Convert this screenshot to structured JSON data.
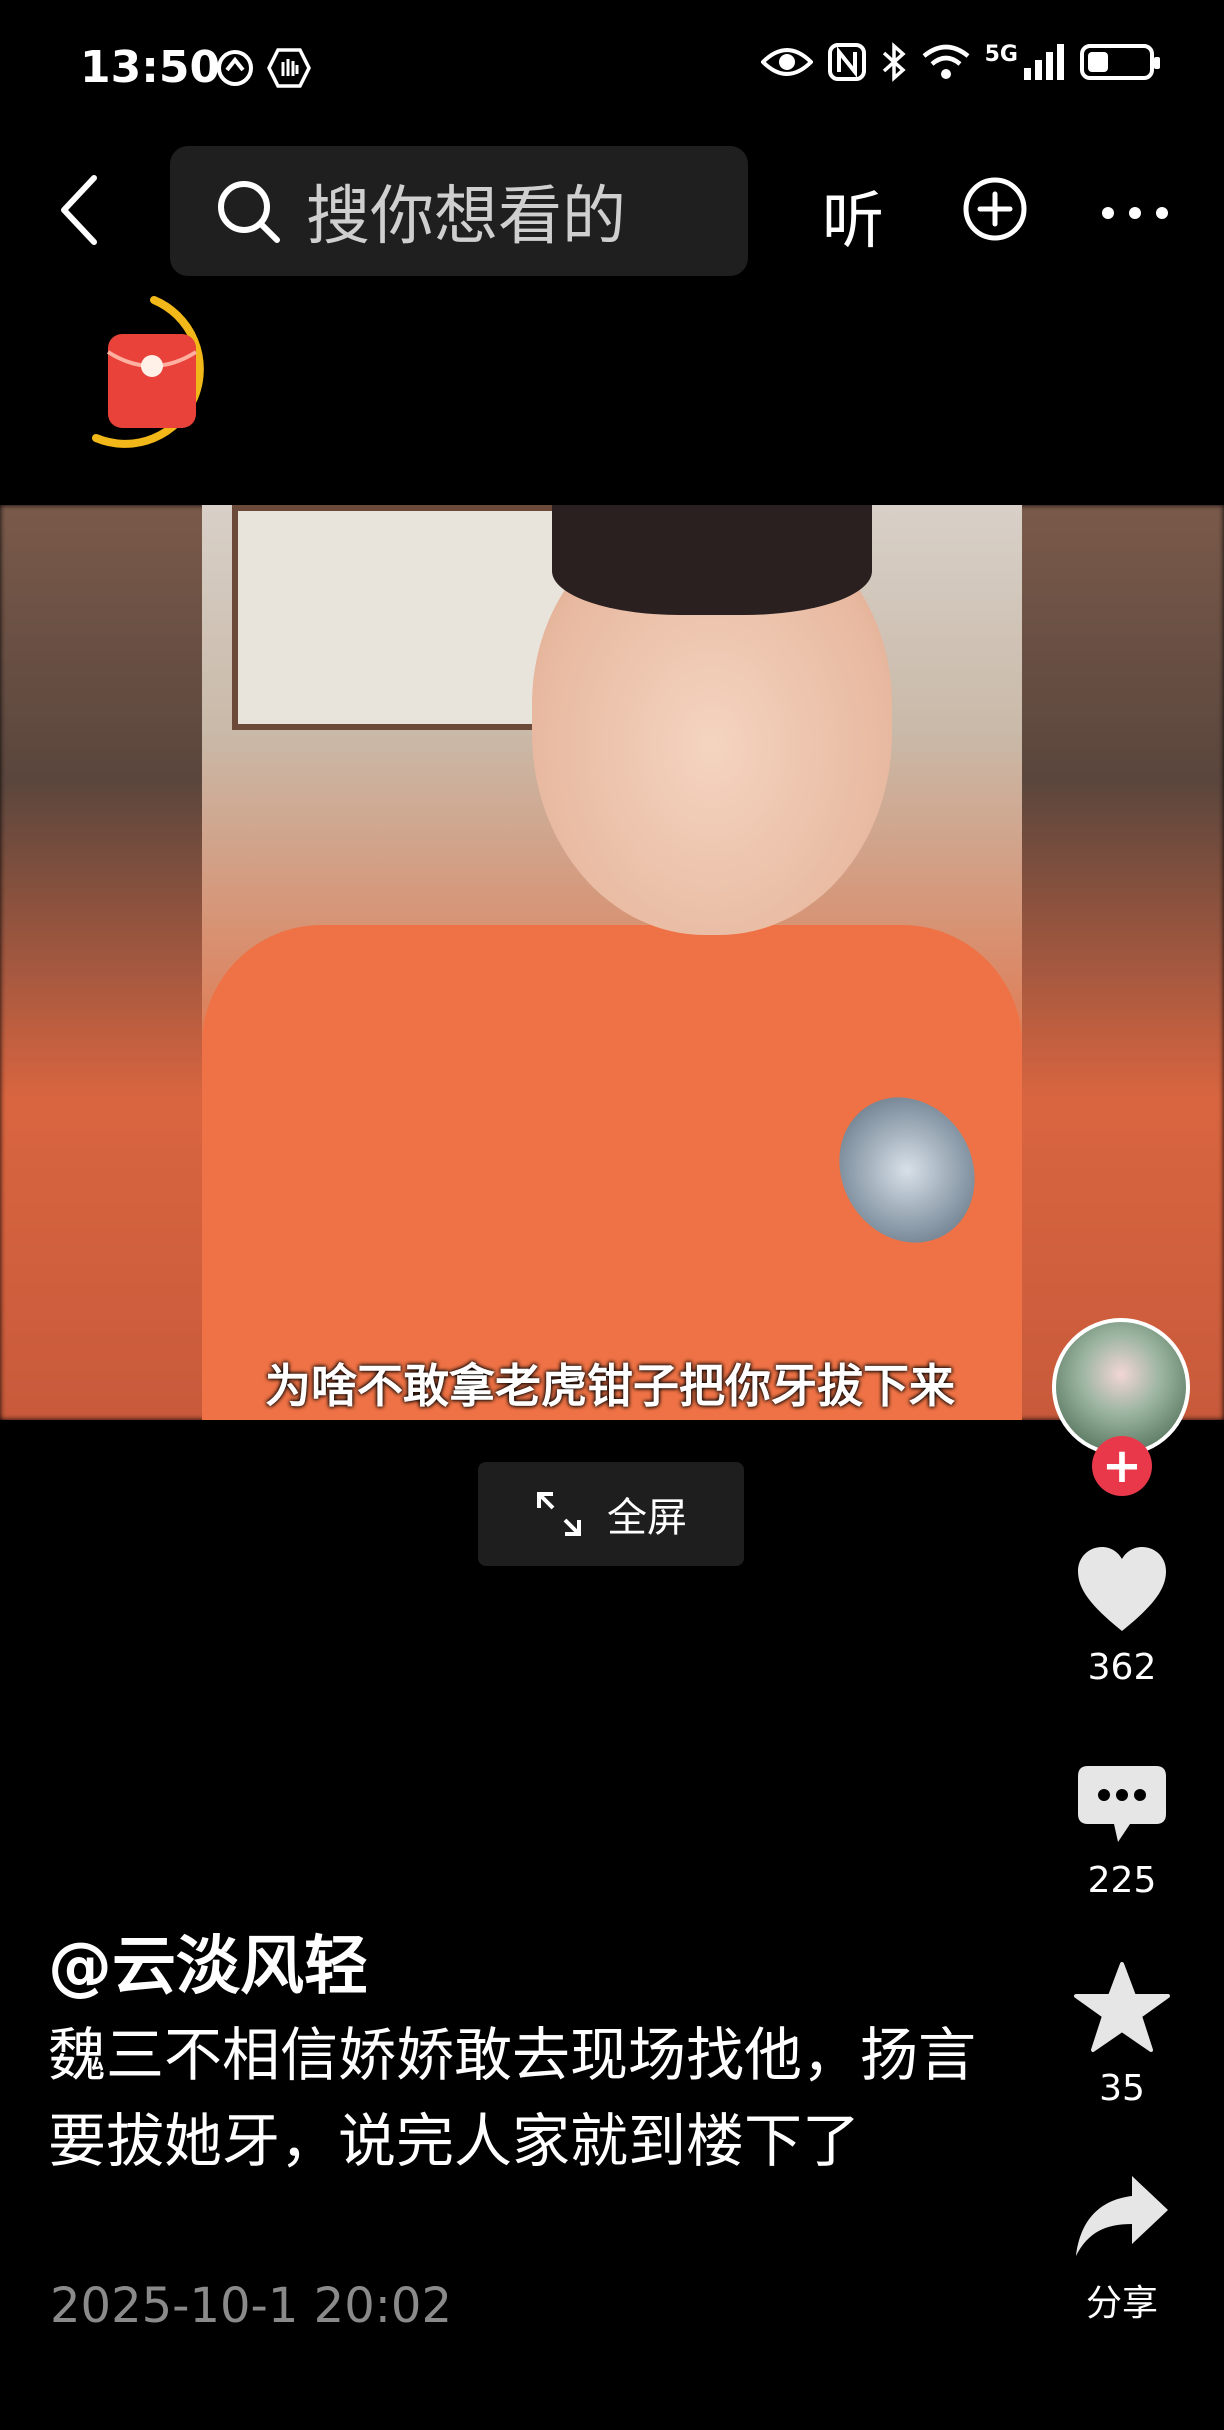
{
  "status_bar": {
    "time": "13:50",
    "network": "5G"
  },
  "top_bar": {
    "search_placeholder": "搜你想看的",
    "listen_label": "听"
  },
  "video": {
    "subtitle": "为啥不敢拿老虎钳子把你牙拔下来"
  },
  "fullscreen": {
    "label": "全屏"
  },
  "actions": {
    "like_count": "362",
    "comment_count": "225",
    "favorite_count": "35",
    "share_label": "分享"
  },
  "post": {
    "author": "@云淡风轻",
    "description": "魏三不相信娇娇敢去现场找他，扬言要拔她牙，说完人家就到楼下了",
    "date": "2025-10-1 20:02"
  }
}
